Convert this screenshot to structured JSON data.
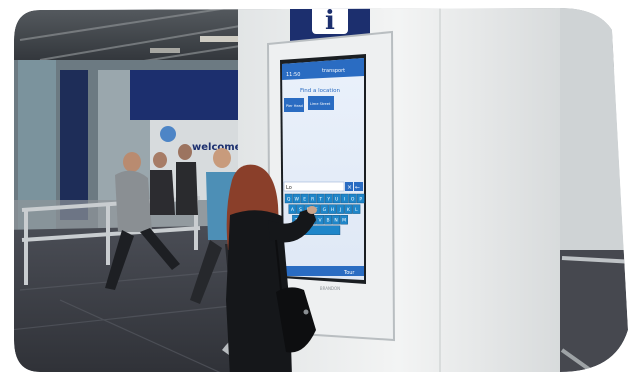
{
  "scene": {
    "description_label": "",
    "kiosk": {
      "top_sign_glyph": "i",
      "header_time": "11:50",
      "header_logo": "transport",
      "search_title": "Find a location",
      "suggestion_buttons": [
        "Pier Head",
        "Lime Street"
      ],
      "input_value": "Lo",
      "keyboard_rows": [
        [
          "Q",
          "W",
          "E",
          "R",
          "T",
          "Y",
          "U",
          "I",
          "O",
          "P"
        ],
        [
          "A",
          "S",
          "D",
          "F",
          "G",
          "H",
          "J",
          "K",
          "L"
        ],
        [
          "Z",
          "X",
          "C",
          "V",
          "B",
          "N",
          "M"
        ]
      ],
      "footer_label": "Tour",
      "brand_text": "BRANDON"
    },
    "station_sign_text": "welcome",
    "colors": {
      "kiosk_body": "#e8ecef",
      "screen_blue": "#2a6cc2",
      "key_blue": "#1f86c9",
      "sign_navy": "#1c2f6e",
      "floor": "#3a3c42"
    }
  }
}
